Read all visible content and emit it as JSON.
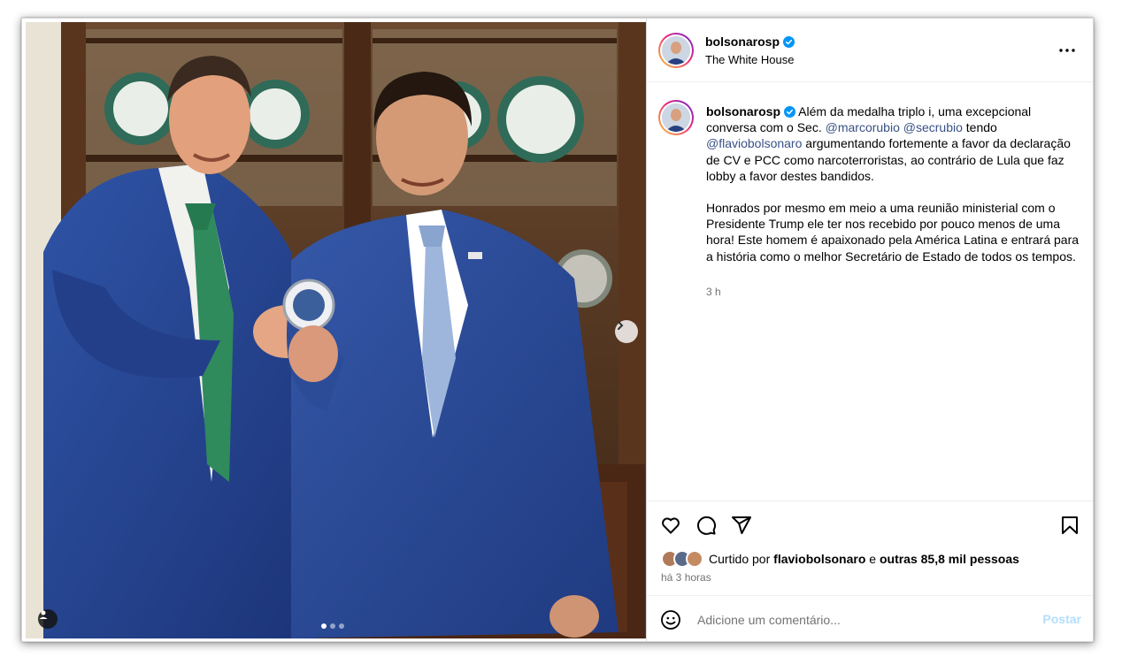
{
  "post": {
    "username": "bolsonarosp",
    "location": "The White House",
    "caption": {
      "username": "bolsonarosp",
      "p1_a": " Além da medalha triplo i, uma excepcional conversa com o Sec. ",
      "mention1": "@marcorubio",
      "mention2": "@secrubio",
      "p1_b": " tendo ",
      "mention3": "@flaviobolsonaro",
      "p1_c": " argumentando fortemente a favor da declaração de CV e PCC como narcoterroristas, ao contrário de Lula que faz lobby a favor destes bandidos.",
      "p2": "Honrados por mesmo em meio a uma reunião ministerial com o Presidente Trump ele ter nos recebido por pouco menos de uma hora! Este homem é apaixonado pela América Latina e entrará para a história como o melhor Secretário de Estado de todos os tempos.",
      "time": "3 h"
    },
    "likes": {
      "prefix": "Curtido por ",
      "user": "flaviobolsonaro",
      "middle": " e ",
      "others": "outras 85,8 mil pessoas"
    },
    "posted": "há 3 horas",
    "comment_placeholder": "Adicione um comentário...",
    "post_button": "Postar"
  },
  "carousel": {
    "total": 3,
    "current": 1
  },
  "icons": {
    "verified": "verified-badge-icon",
    "more": "more-options-icon",
    "like": "heart-icon",
    "comment": "comment-icon",
    "share": "share-icon",
    "save": "bookmark-icon",
    "emoji": "emoji-icon",
    "next": "chevron-right-icon",
    "tag": "user-tag-icon"
  },
  "colors": {
    "verified": "#0095f6",
    "mention": "#385185",
    "post_button": "#b2dffc",
    "secondary_text": "#737373"
  }
}
